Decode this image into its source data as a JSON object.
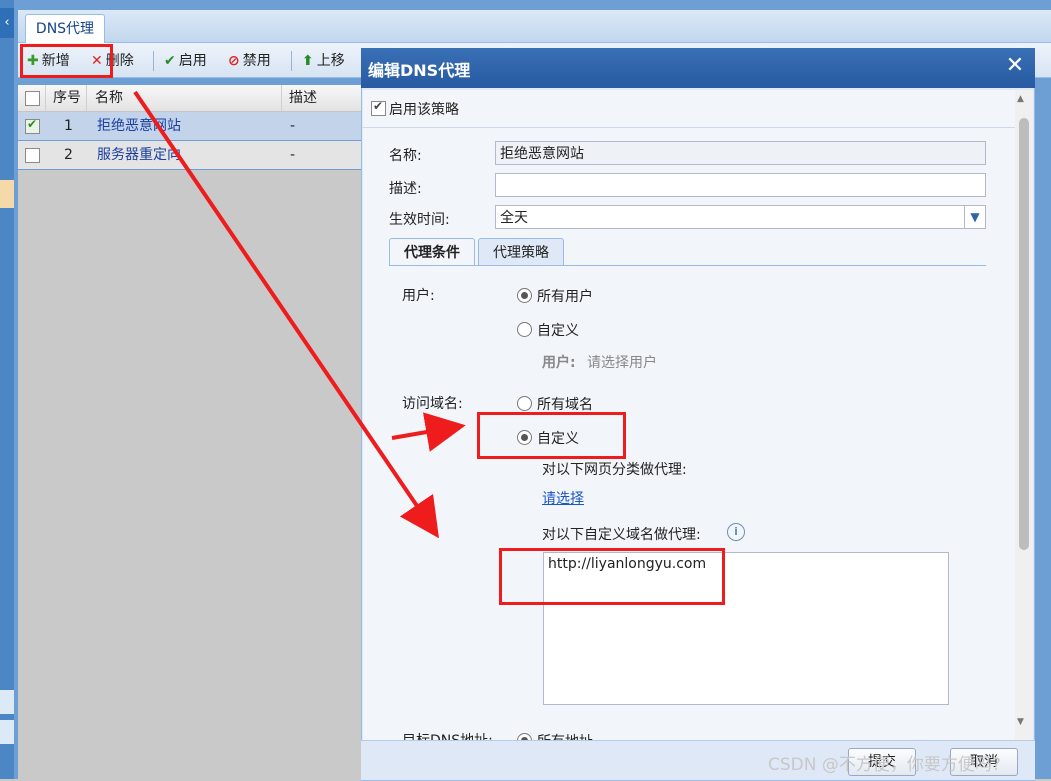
{
  "tabs": [
    {
      "label": "DNS代理"
    }
  ],
  "toolbar": {
    "add_label": "新增",
    "delete_label": "删除",
    "enable_label": "启用",
    "disable_label": "禁用",
    "move_up_label": "上移"
  },
  "grid": {
    "headers": {
      "index": "序号",
      "name": "名称",
      "desc": "描述"
    },
    "rows": [
      {
        "index": "1",
        "name": "拒绝恶意网站",
        "desc": "-",
        "checked": true
      },
      {
        "index": "2",
        "name": "服务器重定向",
        "desc": "-",
        "checked": false
      }
    ]
  },
  "dialog": {
    "title": "编辑DNS代理",
    "enable_policy_label": "启用该策略",
    "name_label": "名称:",
    "name_value": "拒绝恶意网站",
    "desc_label": "描述:",
    "desc_value": "",
    "time_label": "生效时间:",
    "time_value": "全天",
    "tabs": [
      {
        "label": "代理条件"
      },
      {
        "label": "代理策略"
      }
    ],
    "user_label": "用户:",
    "user_options": [
      {
        "label": "所有用户",
        "selected": true
      },
      {
        "label": "自定义",
        "selected": false
      }
    ],
    "user_hint_label": "用户:",
    "user_hint_text": "请选择用户",
    "domain_label": "访问域名:",
    "domain_options": [
      {
        "label": "所有域名",
        "selected": false
      },
      {
        "label": "自定义",
        "selected": true
      }
    ],
    "category_label": "对以下网页分类做代理:",
    "category_link": "请选择",
    "custom_domain_label": "对以下自定义域名做代理:",
    "custom_domain_value": "http://liyanlongyu.com",
    "target_dns_label": "目标DNS地址:",
    "target_dns_option": "所有地址",
    "submit_label": "提交",
    "cancel_label": "取消"
  },
  "watermark": "CSDN @不方便，你要方便吗?",
  "colors": {
    "annotation": "#ee1c1c",
    "link": "#1a56c4",
    "title_bar": "#2f63a8"
  }
}
